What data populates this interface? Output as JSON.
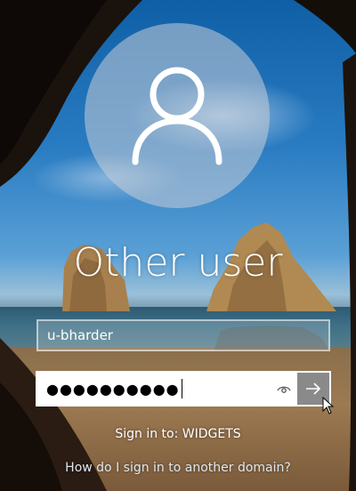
{
  "lock_screen": {
    "user_display_name": "Other user",
    "avatar_icon": "user-silhouette-icon"
  },
  "form": {
    "username_value": "u-bharder",
    "password_mask": "●●●●●●●●●●",
    "reveal_icon": "eye-icon",
    "submit_icon": "arrow-right-icon"
  },
  "footer": {
    "sign_in_to": "Sign in to: WIDGETS",
    "domain_help_link": "How do I sign in to another domain?"
  },
  "colors": {
    "submit_button": "#8a8a8a",
    "password_field_bg": "#ffffff",
    "text": "#ffffff"
  }
}
